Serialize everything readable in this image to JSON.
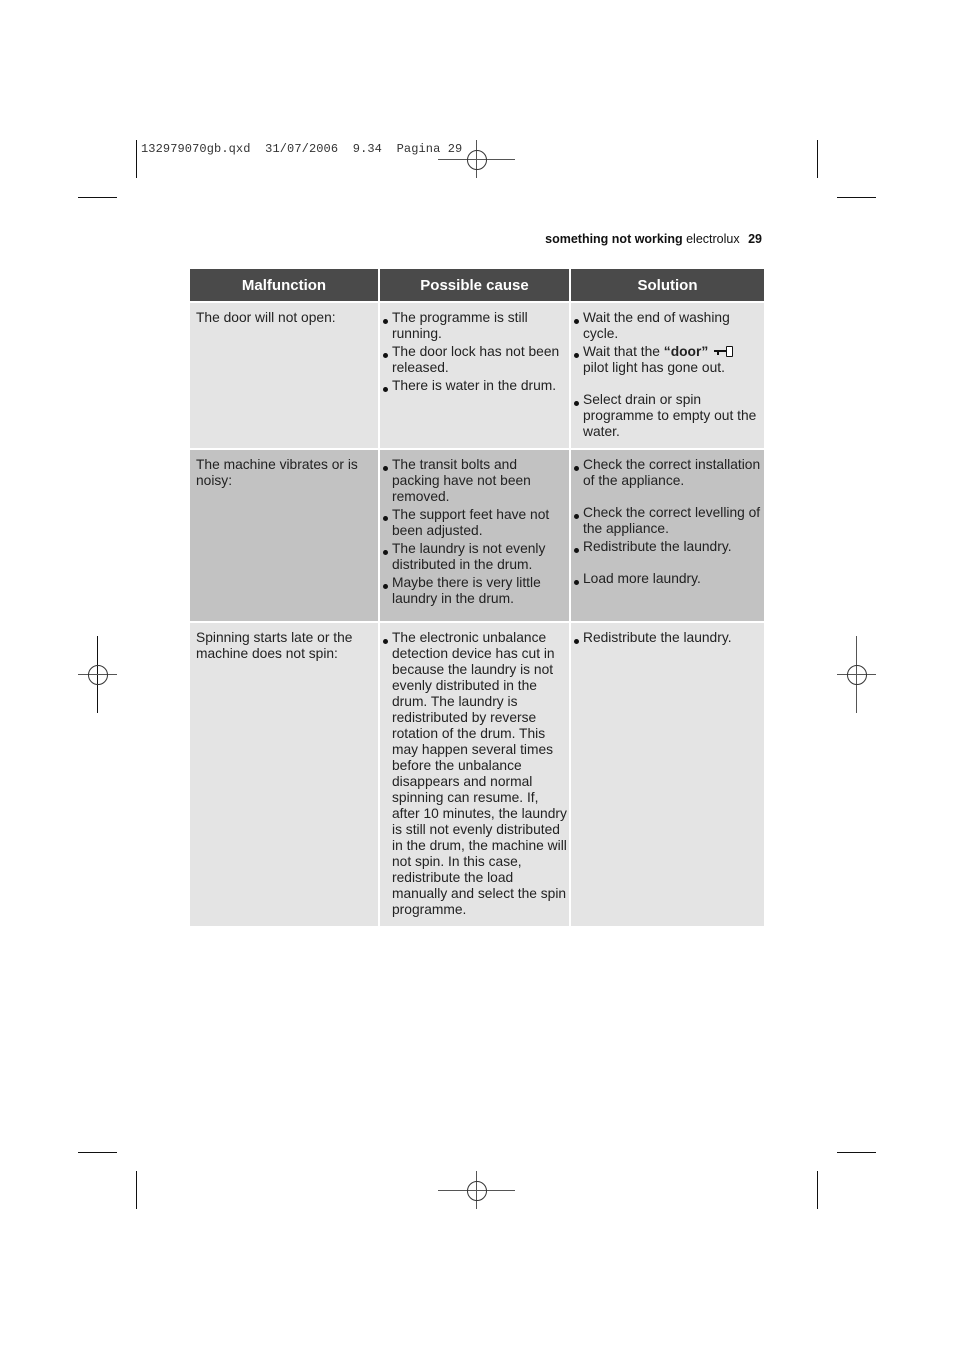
{
  "slug": {
    "file": "132979070gb.qxd",
    "date": "31/07/2006",
    "time": "9.34",
    "page_label": "Pagina",
    "page_number": "29"
  },
  "running_head": {
    "section": "something not working",
    "brand": "electrolux",
    "page": "29"
  },
  "table": {
    "headers": [
      "Malfunction",
      "Possible cause",
      "Solution"
    ],
    "rows": [
      {
        "malfunction": "The door will not open:",
        "causes": [
          "The programme is still running.",
          "The door lock has not been released.",
          "There is water in the drum."
        ],
        "solutions": [
          "Wait the end of washing cycle.",
          "Wait that the",
          "Select drain or spin programme to empty out the water."
        ],
        "door_word": "“door”",
        "door_suffix": "pilot light has gone out.",
        "door_icon": "key-icon"
      },
      {
        "malfunction": "The machine vibrates or is noisy:",
        "causes": [
          "The transit bolts and packing have not been removed.",
          "The support feet have not been adjusted.",
          "The laundry is not evenly distributed in the drum.",
          "Maybe there is very little laundry in the drum."
        ],
        "solutions": [
          "Check the correct installation of the appliance.",
          "Check the correct levelling of the appliance.",
          "Redistribute the laundry.",
          "Load more laundry."
        ]
      },
      {
        "malfunction": "Spinning starts late or the machine does not spin:",
        "causes": [
          "The electronic unbalance detection device has cut in because the laundry is not evenly distributed  in the drum. The laundry is redistributed by reverse rotation of the drum. This may happen several times before the unbalance disappears and normal spinning can resume. If, after 10 minutes, the laundry is still not evenly distributed in the drum, the machine will not spin. In this case, redistribute the load manually and select the spin programme."
        ],
        "solutions": [
          "Redistribute the laundry."
        ]
      }
    ]
  }
}
